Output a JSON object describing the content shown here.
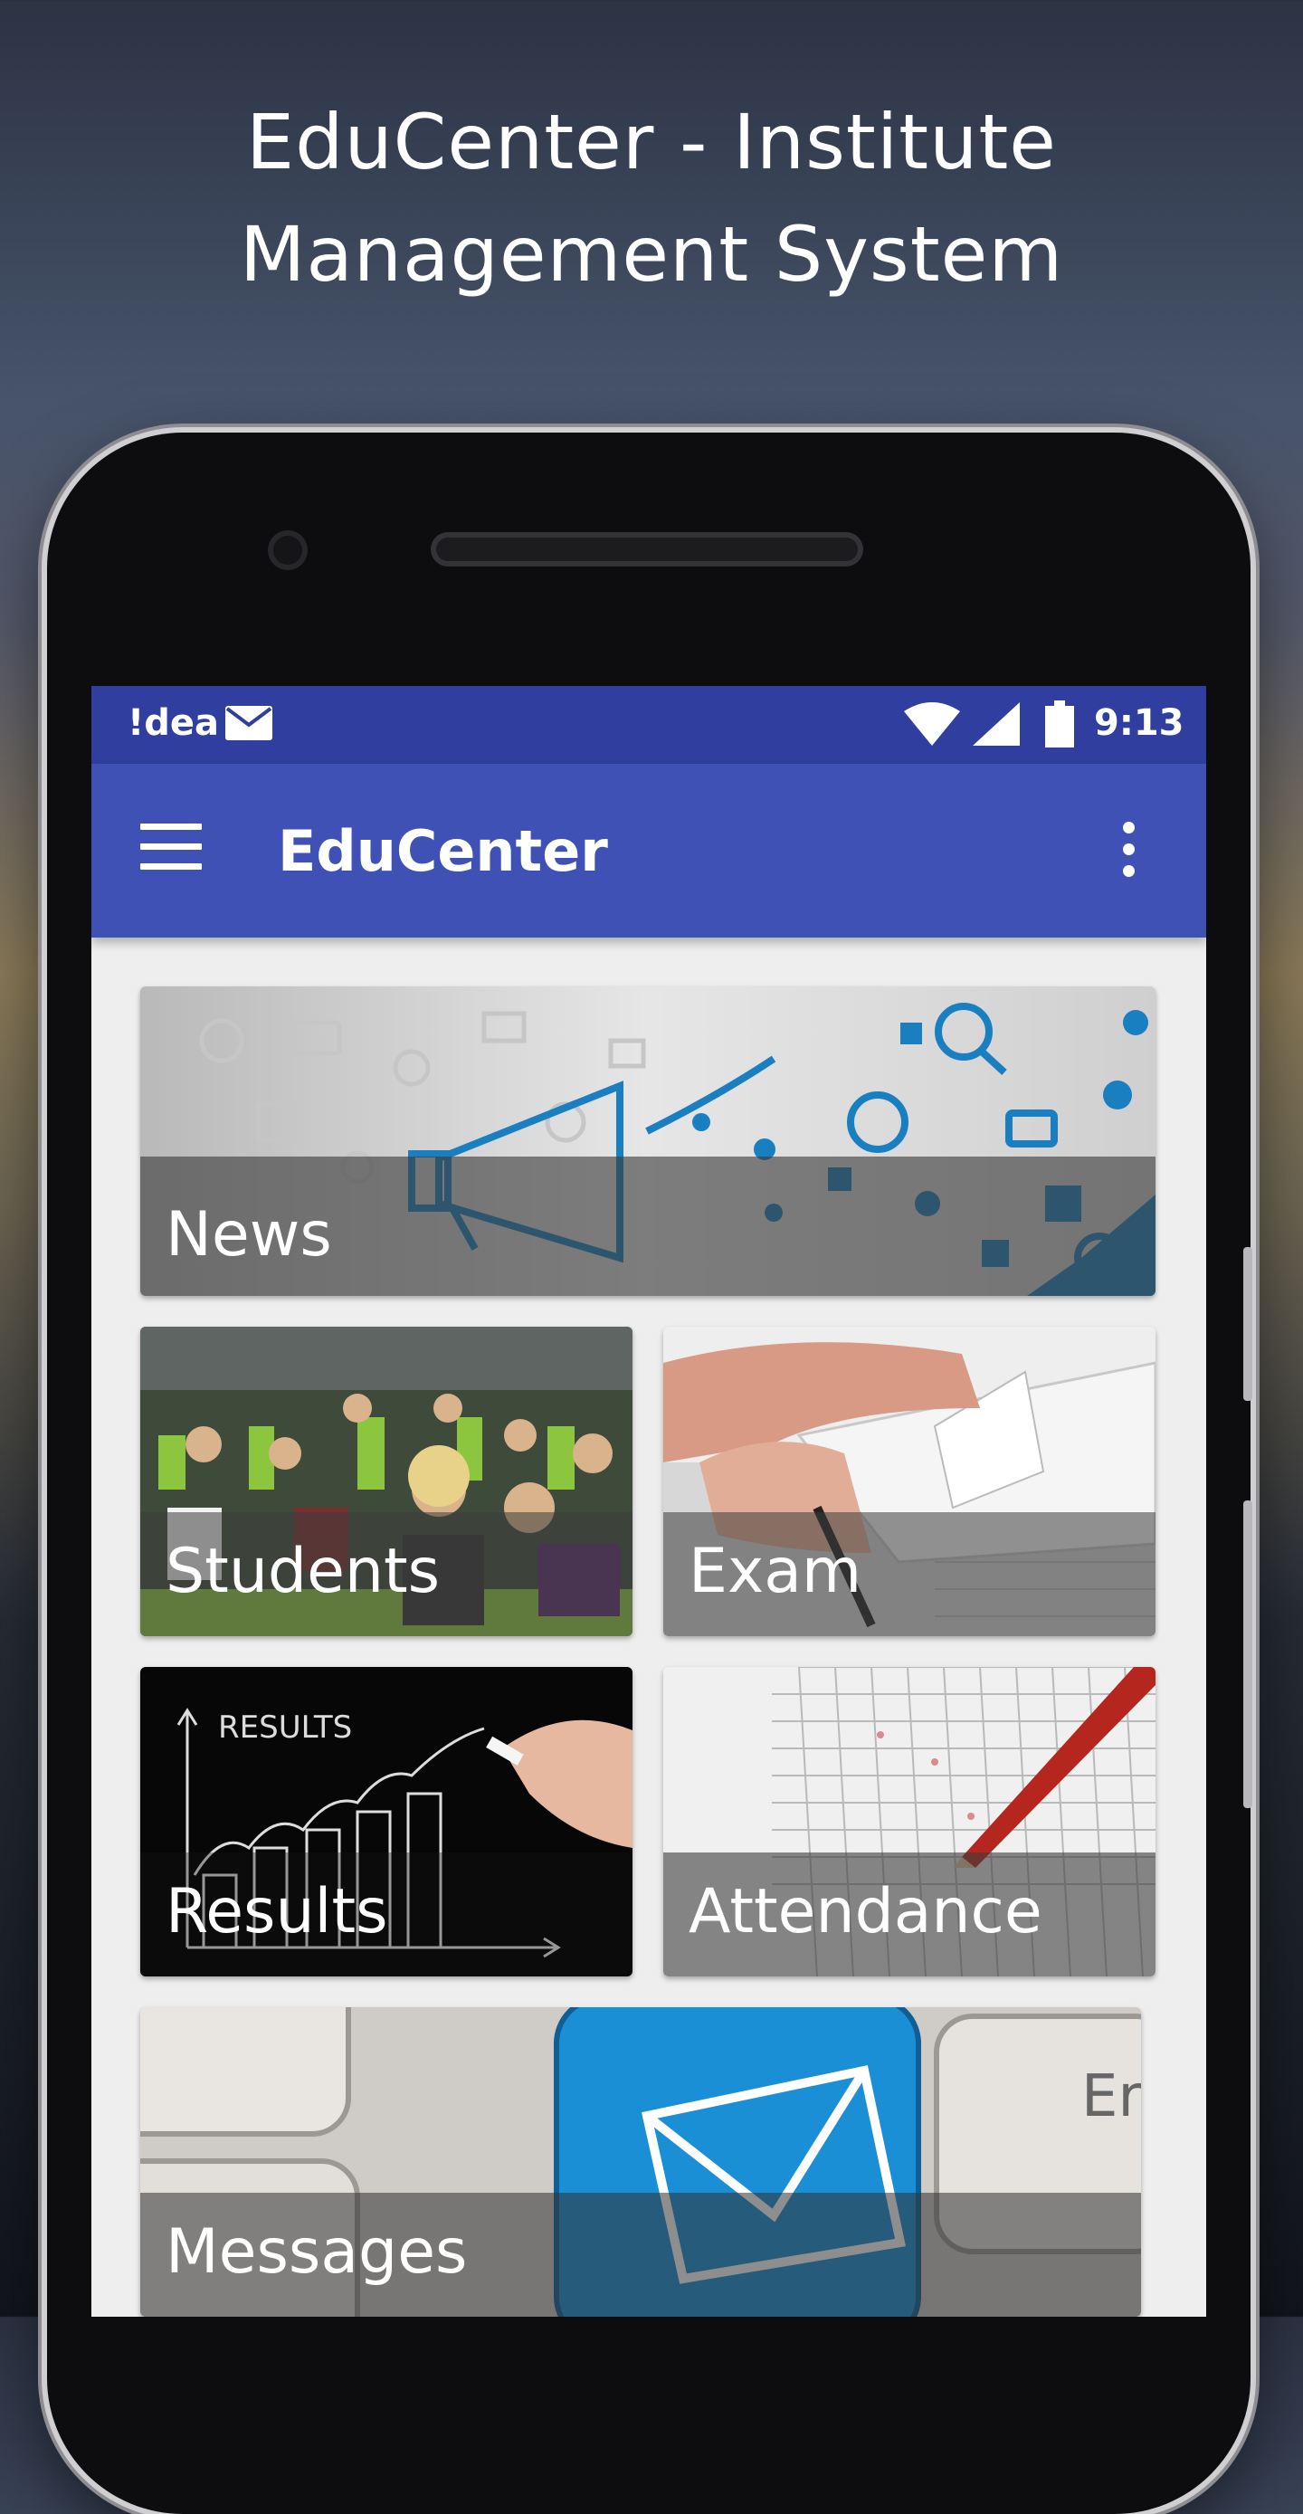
{
  "headline": {
    "line1": "EduCenter - Institute",
    "line2": "Management System"
  },
  "status_bar": {
    "carrier": "!dea",
    "time": "9:13",
    "icons": [
      "mail-icon",
      "wifi-icon",
      "signal-icon",
      "battery-icon"
    ]
  },
  "app_bar": {
    "title": "EduCenter",
    "menu_icon": "hamburger-menu-icon",
    "overflow_icon": "more-vertical-icon"
  },
  "tiles": {
    "news": "News",
    "students": "Students",
    "exam": "Exam",
    "results": "Results",
    "attendance": "Attendance",
    "messages": "Messages"
  },
  "results_chart_text": "RESULTS",
  "colors": {
    "status_bar": "#303f9f",
    "app_bar": "#3f51b5",
    "content_bg": "#eeeeee",
    "accent_blue": "#1a7fc1"
  }
}
